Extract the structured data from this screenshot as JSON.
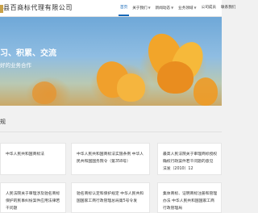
{
  "header": {
    "logo_text": "县百商标代理有限公司",
    "nav": [
      {
        "label": "首页",
        "has_caret": false,
        "active": true
      },
      {
        "label": "关于我们",
        "has_caret": true,
        "active": false
      },
      {
        "label": "新闻动态",
        "has_caret": true,
        "active": false
      },
      {
        "label": "业务领域",
        "has_caret": true,
        "active": false
      },
      {
        "label": "公司成员",
        "has_caret": false,
        "active": false
      },
      {
        "label": "联系我们",
        "has_caret": false,
        "active": false
      }
    ],
    "caret_icon": "▼",
    "accent_color": "#1668b8"
  },
  "banner": {
    "line1": "习、积累、交流",
    "line2": "好的业务合作"
  },
  "section": {
    "title": "规",
    "cards": [
      {
        "text": "中华人民共和国商标法"
      },
      {
        "text": "中华人民共和国商标法实施条例 中华人民共和国国务院令（第358号）"
      },
      {
        "text": "最高人民法院关于审理商标授权确权行政案件若干问题的意见 法发（2010）12"
      },
      {
        "text": "人民法院关于审理涉及驰名商标保护的民事纠纷案件应用法律若干问题"
      },
      {
        "text": "驰名商标认定和保护规定 中华人民共和国国家工商行政管理总局第5号令发"
      },
      {
        "text": "集体商标、证明商标注册和管理办法 中华人民共和国国家工商行政管理局"
      }
    ]
  }
}
